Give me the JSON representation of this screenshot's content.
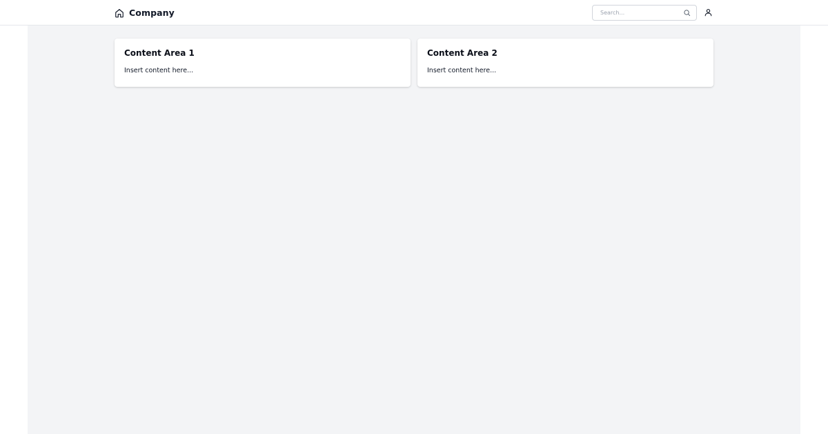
{
  "header": {
    "brand": {
      "icon": "home-icon",
      "name": "Company"
    },
    "search": {
      "placeholder": "Search...",
      "value": "",
      "icon": "search-icon"
    },
    "user_icon": "user-icon"
  },
  "main": {
    "background": "#f3f4f6",
    "cards": [
      {
        "title": "Content Area 1",
        "body": "Insert content here..."
      },
      {
        "title": "Content Area 2",
        "body": "Insert content here..."
      }
    ]
  }
}
